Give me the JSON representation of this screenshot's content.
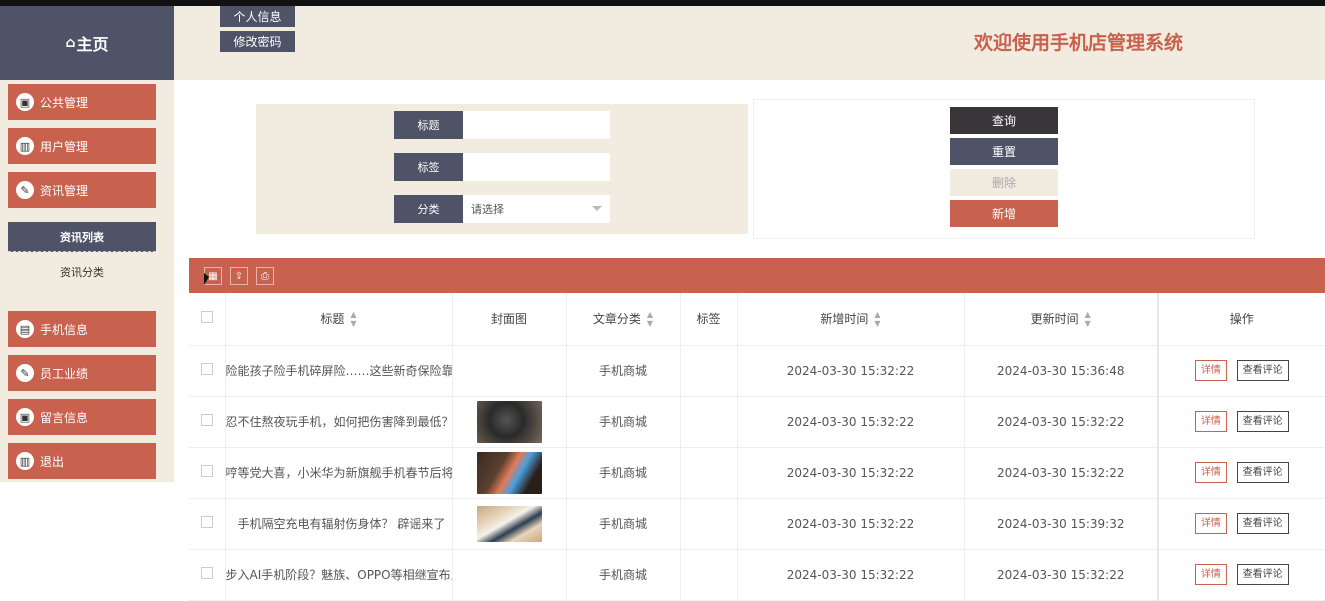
{
  "sidebar": {
    "home_label": "主页",
    "home_icon": "home-icon",
    "menu": [
      {
        "label": "公共管理",
        "icon": "monitor-icon"
      },
      {
        "label": "用户管理",
        "icon": "chart-icon"
      },
      {
        "label": "资讯管理",
        "icon": "edit-icon"
      },
      {
        "label": "手机信息",
        "icon": "clipboard-icon"
      },
      {
        "label": "员工业绩",
        "icon": "edit-icon"
      },
      {
        "label": "留言信息",
        "icon": "monitor-icon"
      },
      {
        "label": "退出",
        "icon": "chart-icon"
      }
    ],
    "sub": [
      {
        "label": "资讯列表",
        "active": true
      },
      {
        "label": "资讯分类",
        "active": false
      }
    ]
  },
  "header": {
    "profile_btn": "个人信息",
    "password_btn": "修改密码",
    "welcome": "欢迎使用手机店管理系统"
  },
  "search": {
    "title_label": "标题",
    "title_value": "",
    "tag_label": "标签",
    "tag_value": "",
    "category_label": "分类",
    "category_placeholder": "请选择"
  },
  "actions": {
    "query": "查询",
    "reset": "重置",
    "delete": "删除",
    "add": "新增"
  },
  "toolbar_icons": [
    "columns-icon",
    "export-icon",
    "print-icon"
  ],
  "table": {
    "headers": [
      "标题",
      "封面图",
      "文章分类",
      "标签",
      "新增时间",
      "更新时间",
      "操作"
    ],
    "detail_label": "详情",
    "comment_label": "查看评论",
    "rows": [
      {
        "title": "险能孩子险手机碎屏险……这些新奇保险靠谱",
        "category": "手机商城",
        "tag": "",
        "created": "2024-03-30 15:32:22",
        "updated": "2024-03-30 15:36:48",
        "cover": "partial"
      },
      {
        "title": "忍不住熬夜玩手机，如何把伤害降到最低？",
        "category": "手机商城",
        "tag": "",
        "created": "2024-03-30 15:32:22",
        "updated": "2024-03-30 15:32:22",
        "cover": "dark-phone"
      },
      {
        "title": "哼等党大喜，小米华为新旗舰手机春节后将发布",
        "category": "手机商城",
        "tag": "",
        "created": "2024-03-30 15:32:22",
        "updated": "2024-03-30 15:32:22",
        "cover": "colorful-phone"
      },
      {
        "title": "手机隔空充电有辐射伤身体？ 辟谣来了",
        "category": "手机商城",
        "tag": "",
        "created": "2024-03-30 15:32:22",
        "updated": "2024-03-30 15:39:32",
        "cover": "white-phone"
      },
      {
        "title": "步入AI手机阶段？魅族、OPPO等相继宣布入局",
        "category": "手机商城",
        "tag": "",
        "created": "2024-03-30 15:32:22",
        "updated": "2024-03-30 15:32:22",
        "cover": "partial-bottom"
      }
    ]
  },
  "colors": {
    "accent": "#c8614d",
    "dark": "#4e5367",
    "cream": "#f1ebe0"
  }
}
